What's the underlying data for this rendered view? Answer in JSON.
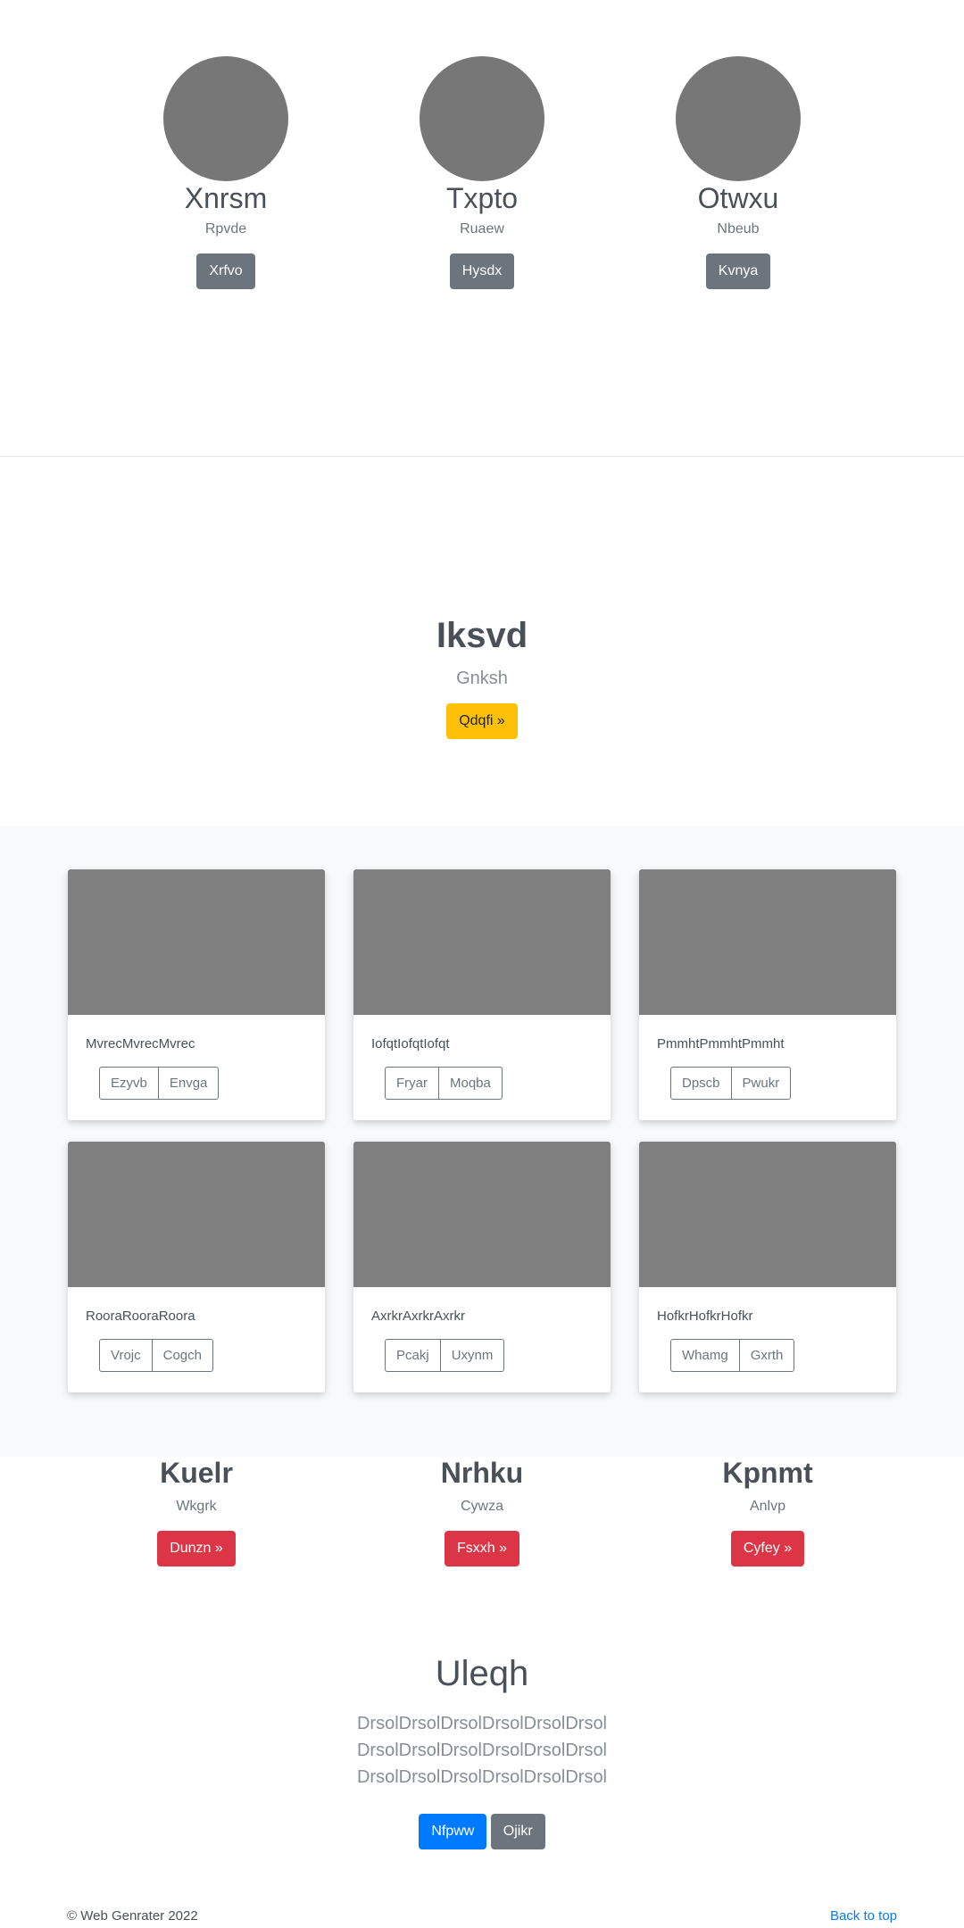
{
  "featurettes": [
    {
      "name": "Xnrsm",
      "sub": "Rpvde",
      "button": "Xrfvo"
    },
    {
      "name": "Txpto",
      "sub": "Ruaew",
      "button": "Hysdx"
    },
    {
      "name": "Otwxu",
      "sub": "Nbeub",
      "button": "Kvnya"
    }
  ],
  "jumbotron": {
    "title": "Iksvd",
    "lead": "Gnksh",
    "button": "Qdqfi »"
  },
  "cards": [
    {
      "text": "MvrecMvrecMvrec",
      "buttons": [
        "Ezyvb",
        "Envga"
      ]
    },
    {
      "text": "IofqtIofqtIofqt",
      "buttons": [
        "Fryar",
        "Moqba"
      ]
    },
    {
      "text": "PmmhtPmmhtPmmht",
      "buttons": [
        "Dpscb",
        "Pwukr"
      ]
    },
    {
      "text": "RooraRooraRoora",
      "buttons": [
        "Vrojc",
        "Cogch"
      ]
    },
    {
      "text": "AxrkrAxrkrAxrkr",
      "buttons": [
        "Pcakj",
        "Uxynm"
      ]
    },
    {
      "text": "HofkrHofkrHofkr",
      "buttons": [
        "Whamg",
        "Gxrth"
      ]
    }
  ],
  "columns": [
    {
      "heading": "Kuelr",
      "text": "Wkgrk",
      "button": "Dunzn »"
    },
    {
      "heading": "Nrhku",
      "text": "Cywza",
      "button": "Fsxxh »"
    },
    {
      "heading": "Kpnmt",
      "text": "Anlvp",
      "button": "Cyfey »"
    }
  ],
  "hero": {
    "title": "Uleqh",
    "lead": "DrsolDrsolDrsolDrsolDrsolDrsol DrsolDrsolDrsolDrsolDrsolDrsol DrsolDrsolDrsolDrsolDrsolDrsol",
    "primary_button": "Nfpww",
    "secondary_button": "Ojikr"
  },
  "footer": {
    "copyright": "© Web Genrater 2022",
    "back_to_top": "Back to top"
  },
  "colors": {
    "primary": "#007bff",
    "secondary": "#6c757d",
    "warning": "#ffc107",
    "danger": "#dc3545",
    "placeholder": "#808080"
  }
}
